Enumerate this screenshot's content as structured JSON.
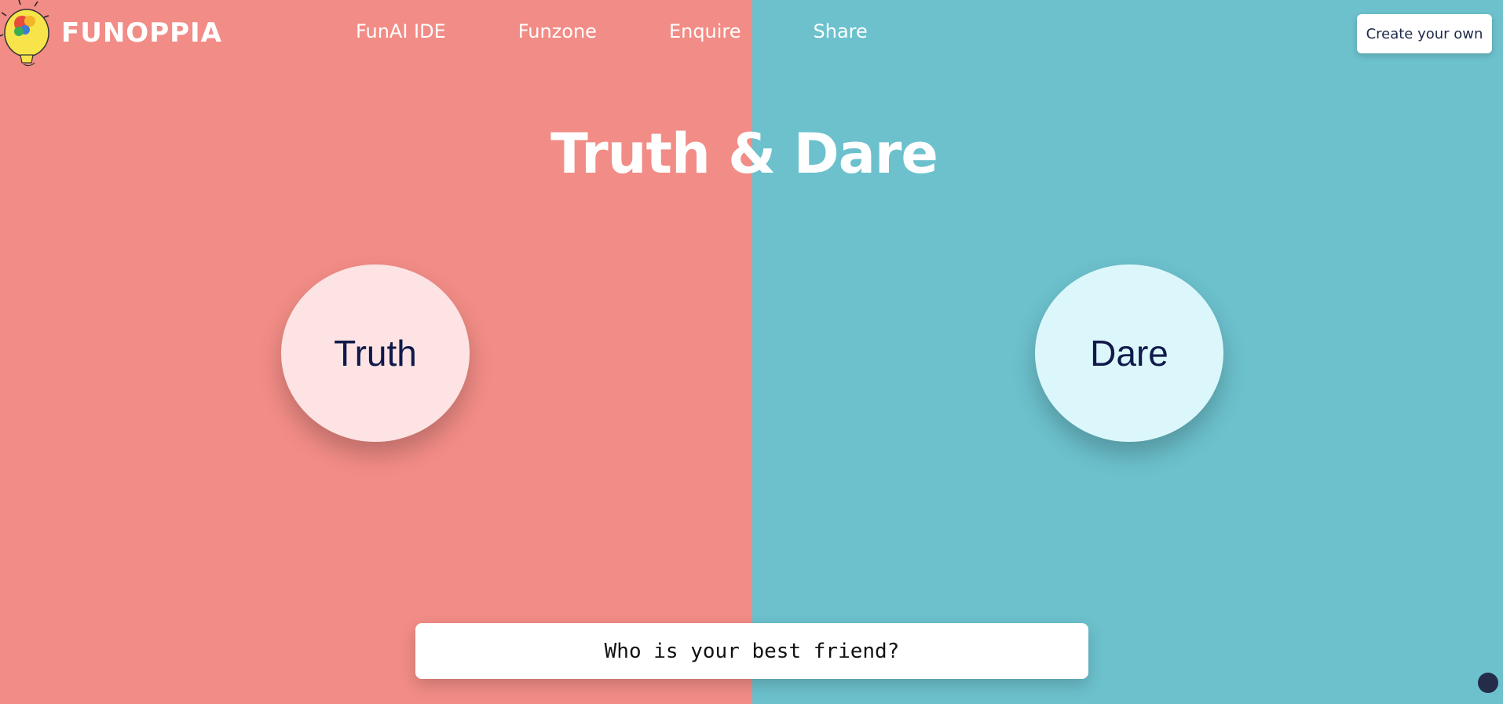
{
  "brand": {
    "name": "FUNOPPIA"
  },
  "nav": {
    "items": [
      {
        "label": "FunAI IDE"
      },
      {
        "label": "Funzone"
      },
      {
        "label": "Enquire"
      },
      {
        "label": "Share"
      }
    ]
  },
  "header": {
    "create_label": "Create your own"
  },
  "main": {
    "title": "Truth & Dare",
    "truth_label": "Truth",
    "dare_label": "Dare",
    "question": "Who is your best friend?"
  },
  "colors": {
    "left_bg": "#f28c86",
    "right_bg": "#6cc1cd",
    "truth_circle": "#fde3e3",
    "dare_circle": "#dcf7fb",
    "chat_dot": "#252c4a"
  }
}
